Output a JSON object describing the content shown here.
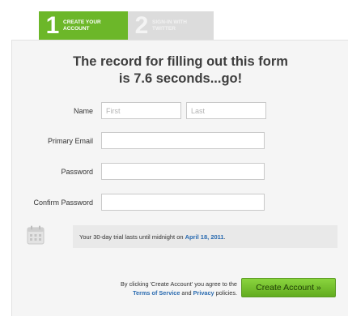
{
  "steps": [
    {
      "number": "1",
      "label_line1": "CREATE YOUR",
      "label_line2": "ACCOUNT"
    },
    {
      "number": "2",
      "label_line1": "SIGN-IN WITH",
      "label_line2": "TWITTER"
    }
  ],
  "headline": {
    "line1": "The record for filling out this form",
    "line2": "is 7.6 seconds...go!"
  },
  "form": {
    "name_label": "Name",
    "first_placeholder": "First",
    "last_placeholder": "Last",
    "email_label": "Primary Email",
    "password_label": "Password",
    "confirm_label": "Confirm Password"
  },
  "trial": {
    "text_before": "Your 30-day trial lasts until midnight on ",
    "date": "April 18, 2011",
    "text_after": "."
  },
  "terms": {
    "line1": "By clicking 'Create Account' you agree to the",
    "tos_link": "Terms of Service",
    "and": " and ",
    "privacy_link": "Privacy",
    "policies": " policies."
  },
  "create_button": "Create Account »",
  "colors": {
    "accent": "#6cb729",
    "link": "#2a6bb0",
    "inactive_tab": "#dcdcdc"
  }
}
